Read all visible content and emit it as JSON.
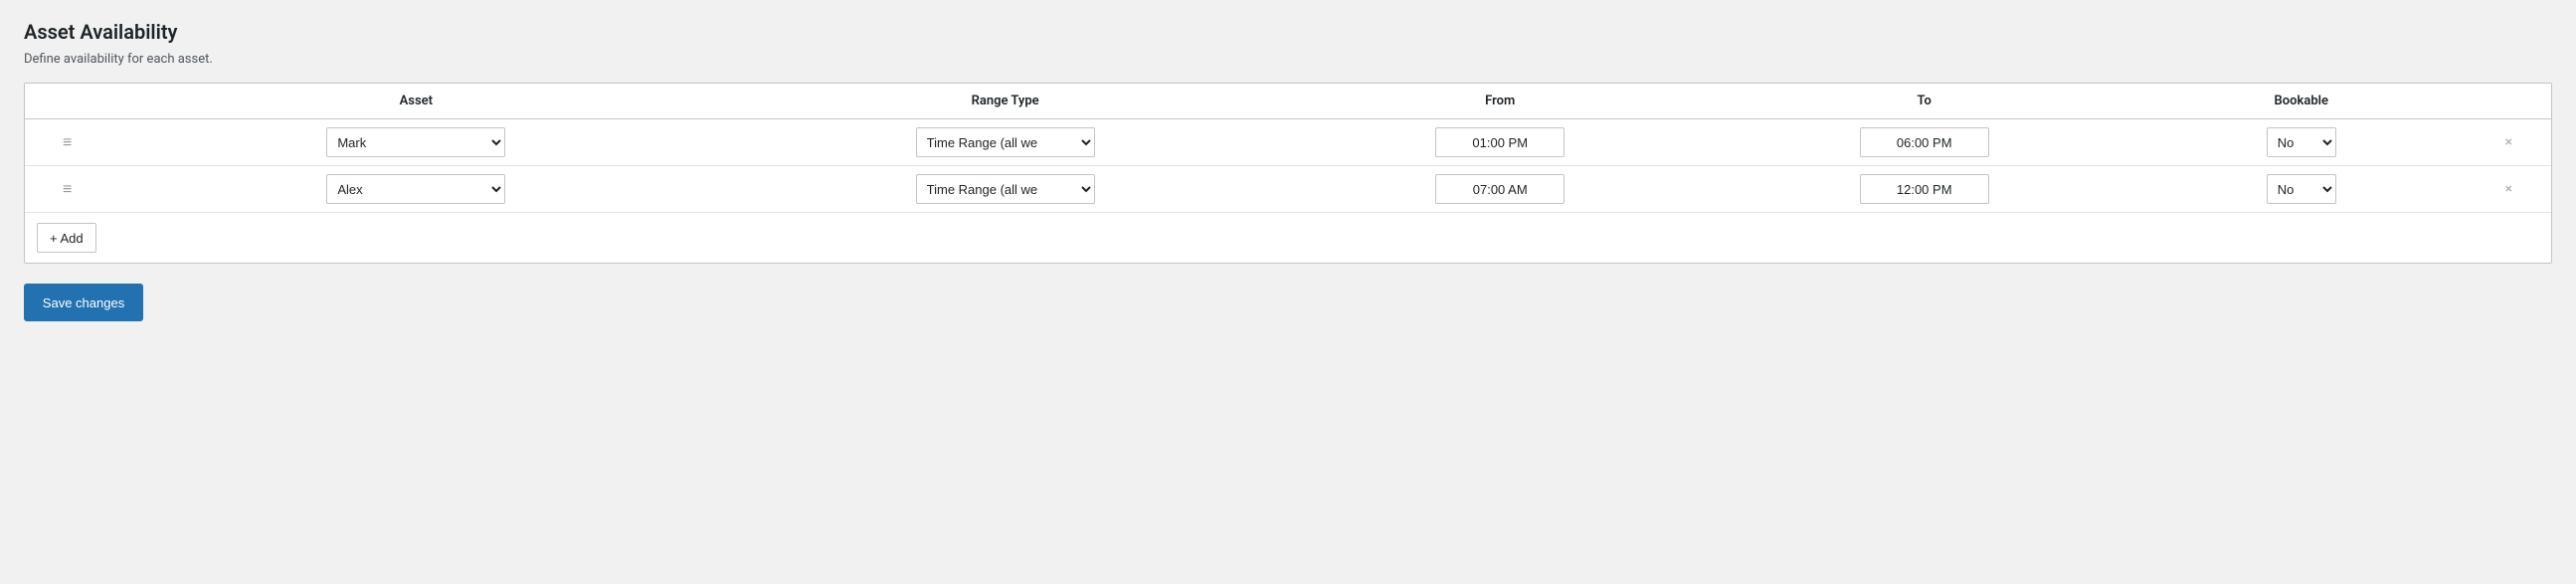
{
  "page": {
    "title": "Asset Availability",
    "description": "Define availability for each asset."
  },
  "table": {
    "headers": {
      "drag": "",
      "asset": "Asset",
      "range_type": "Range Type",
      "from": "From",
      "to": "To",
      "bookable": "Bookable",
      "action": ""
    },
    "rows": [
      {
        "id": 1,
        "asset_value": "Mark",
        "range_type_value": "Time Range (all we",
        "from_value": "01:00 PM",
        "to_value": "06:00 PM",
        "bookable_value": "No"
      },
      {
        "id": 2,
        "asset_value": "Alex",
        "range_type_value": "Time Range (all we",
        "from_value": "07:00 AM",
        "to_value": "12:00 PM",
        "bookable_value": "No"
      }
    ]
  },
  "buttons": {
    "add_label": "+ Add",
    "save_label": "Save changes"
  },
  "icons": {
    "drag": "≡",
    "remove": "×"
  }
}
